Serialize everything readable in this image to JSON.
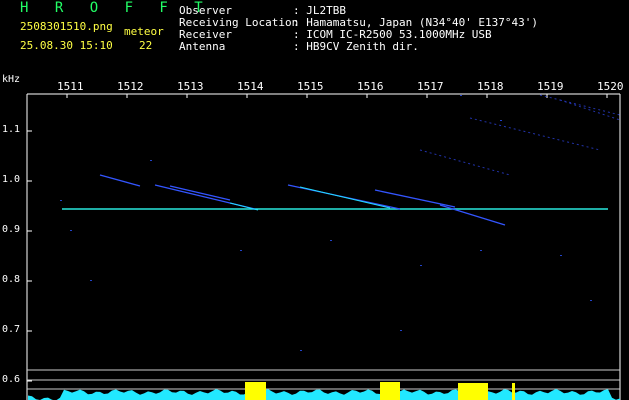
{
  "header": {
    "app_logo": "H R O F F T",
    "filename": "2508301510.png",
    "datetime": "25.08.30 15:10",
    "mode_label": "meteor",
    "meteor_count": "22",
    "fields": [
      {
        "label": "Observer",
        "value": ": JL2TBB"
      },
      {
        "label": "Receiving Location",
        "value": ": Hamamatsu, Japan (N34°40' E137°43')"
      },
      {
        "label": "Receiver",
        "value": ": ICOM IC-R2500 53.1000MHz USB"
      },
      {
        "label": "Antenna",
        "value": ": HB9CV Zenith dir."
      }
    ]
  },
  "spectrogram": {
    "y_unit": "kHz",
    "x_ticks": [
      "1511",
      "1512",
      "1513",
      "1514",
      "1515",
      "1516",
      "1517",
      "1518",
      "1519",
      "1520"
    ],
    "y_ticks": [
      "1.1",
      "1.0",
      "0.9",
      "0.8",
      "0.7",
      "0.6"
    ],
    "colors": {
      "signal": "#22ddff",
      "echo": "#3355ff",
      "level_bar": "#22e8ff",
      "burst": "#ffff00",
      "ref_line": "#cccccc"
    }
  }
}
